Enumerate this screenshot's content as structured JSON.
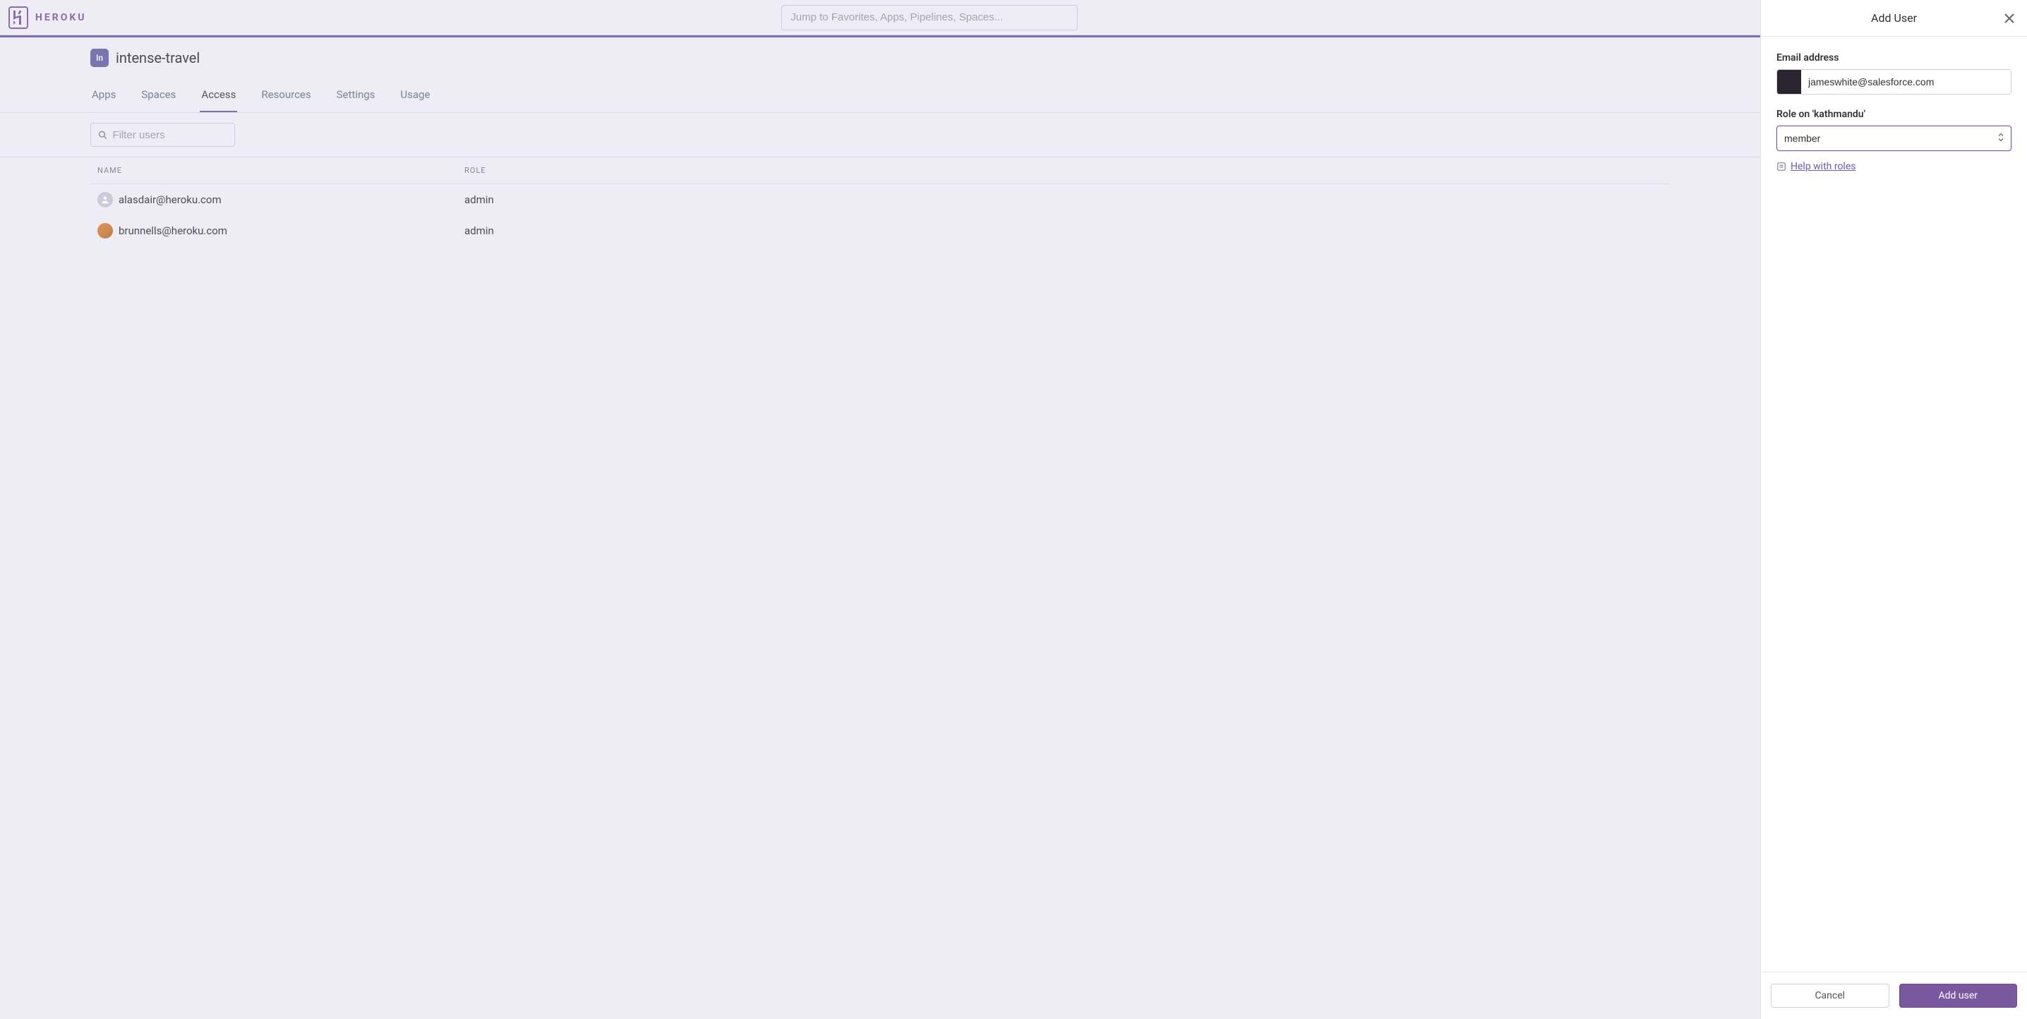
{
  "brand": {
    "name": "HEROKU"
  },
  "search": {
    "placeholder": "Jump to Favorites, Apps, Pipelines, Spaces..."
  },
  "app": {
    "badge": "In",
    "name": "intense-travel"
  },
  "tabs": [
    {
      "label": "Apps",
      "active": false
    },
    {
      "label": "Spaces",
      "active": false
    },
    {
      "label": "Access",
      "active": true
    },
    {
      "label": "Resources",
      "active": false
    },
    {
      "label": "Settings",
      "active": false
    },
    {
      "label": "Usage",
      "active": false
    }
  ],
  "filter": {
    "placeholder": "Filter users"
  },
  "table": {
    "columns": {
      "name": "NAME",
      "role": "ROLE"
    },
    "rows": [
      {
        "email": "alasdair@heroku.com",
        "role": "admin",
        "avatar": "placeholder"
      },
      {
        "email": "brunnells@heroku.com",
        "role": "admin",
        "avatar": "photo"
      }
    ]
  },
  "panel": {
    "title": "Add User",
    "email_label": "Email address",
    "email_value": "jameswhite@salesforce.com",
    "role_label": "Role on 'kathmandu'",
    "role_value": "member",
    "help_text": "Help with roles",
    "cancel": "Cancel",
    "submit": "Add user"
  }
}
